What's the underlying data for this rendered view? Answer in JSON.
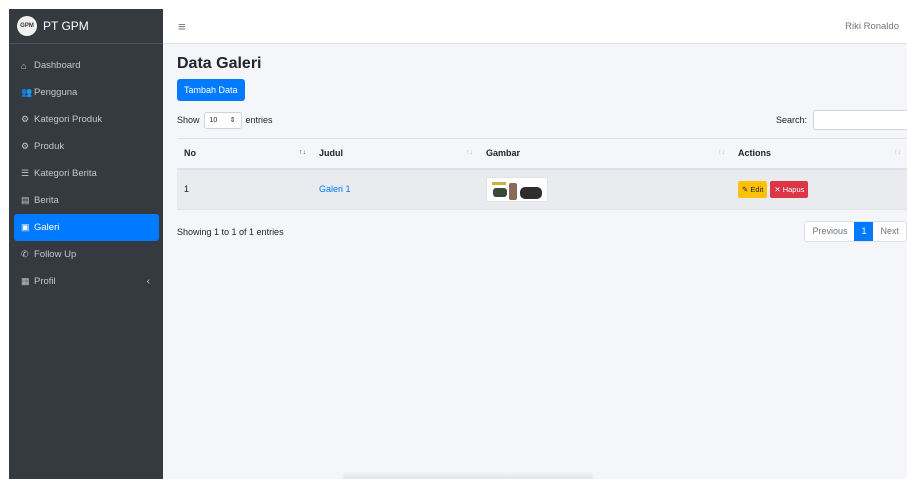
{
  "brand": {
    "logo_text": "GPM",
    "name": "PT GPM"
  },
  "sidebar": {
    "items": [
      {
        "label": "Dashboard",
        "icon": "home-icon",
        "glyph": "⌂"
      },
      {
        "label": "Pengguna",
        "icon": "users-icon",
        "glyph": "👥"
      },
      {
        "label": "Kategori Produk",
        "icon": "motorcycle-icon",
        "glyph": "⚙"
      },
      {
        "label": "Produk",
        "icon": "motorcycle-icon",
        "glyph": "⚙"
      },
      {
        "label": "Kategori Berita",
        "icon": "list-icon",
        "glyph": "☰"
      },
      {
        "label": "Berita",
        "icon": "newspaper-icon",
        "glyph": "▤"
      },
      {
        "label": "Galeri",
        "icon": "image-icon",
        "glyph": "▣"
      },
      {
        "label": "Follow Up",
        "icon": "phone-icon",
        "glyph": "✆"
      },
      {
        "label": "Profil",
        "icon": "building-icon",
        "glyph": "▦"
      }
    ],
    "active": "Galeri",
    "profil_chevron": "‹"
  },
  "topbar": {
    "menu_glyph": "≡",
    "user_name": "Riki Ronaldo"
  },
  "page": {
    "title": "Data Galeri",
    "add_button": "Tambah Data",
    "show_label": "Show",
    "entries_value": "10",
    "entries_label": "entries",
    "search_label": "Search:",
    "search_value": ""
  },
  "table": {
    "columns": [
      "No",
      "Judul",
      "Gambar",
      "Actions"
    ],
    "rows": [
      {
        "no": "1",
        "judul": "Galeri 1",
        "gambar": "image-thumbnail",
        "edit": "Edit",
        "delete": "Hapus"
      }
    ]
  },
  "footer": {
    "info": "Showing 1 to 1 of 1 entries",
    "previous": "Previous",
    "current_page": "1",
    "next": "Next"
  },
  "colors": {
    "sidebar_bg": "#343a40",
    "primary": "#007bff",
    "warning": "#ffc107",
    "danger": "#dc3545",
    "content_bg": "#f4f6f9"
  }
}
